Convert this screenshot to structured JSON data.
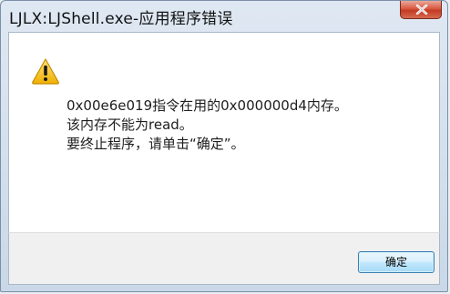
{
  "window": {
    "title": "LJLX:LJShell.exe-应用程序错误"
  },
  "icons": {
    "close": "close-icon",
    "warning": "warning-icon"
  },
  "message": {
    "lines": [
      "0x00e6e019指令在用的0x000000d4内存。",
      "该内存不能为read。",
      "要终止程序，请单击“确定”。"
    ]
  },
  "buttons": {
    "ok_label": "确定"
  },
  "colors": {
    "close_button": "#c7432a",
    "ok_button_border": "#3c7fb1",
    "warning_fill": "#f4c22c"
  }
}
